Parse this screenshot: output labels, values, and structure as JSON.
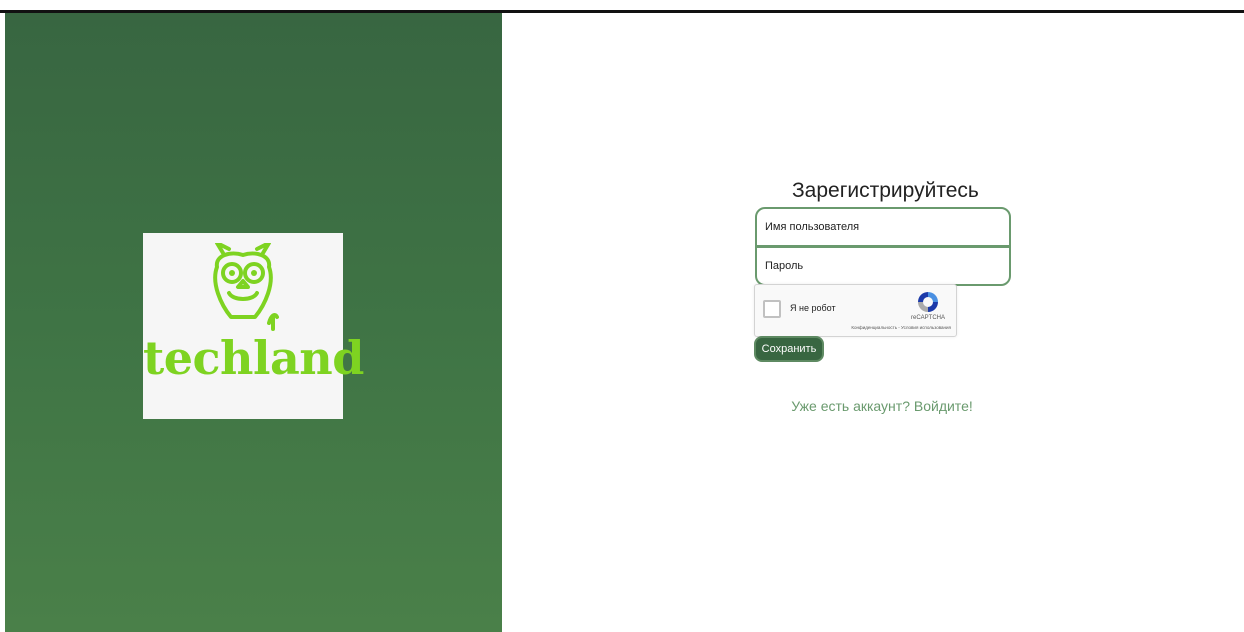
{
  "brand": {
    "logo_text": "techland",
    "logo_icon": "owl-icon",
    "logo_color": "#7ed321"
  },
  "colors": {
    "primary": "#386641",
    "border": "#6a9a6e",
    "link": "#6a9a6e"
  },
  "form": {
    "title": "Зарегистрируйтесь",
    "username_placeholder": "Имя пользователя",
    "password_placeholder": "Пароль",
    "save_label": "Сохранить",
    "login_link_text": "Уже есть аккаунт? Войдите!"
  },
  "recaptcha": {
    "checkbox_label": "Я не робот",
    "brand": "reCAPTCHA",
    "links": "Конфиденциальность - Условия использования"
  }
}
